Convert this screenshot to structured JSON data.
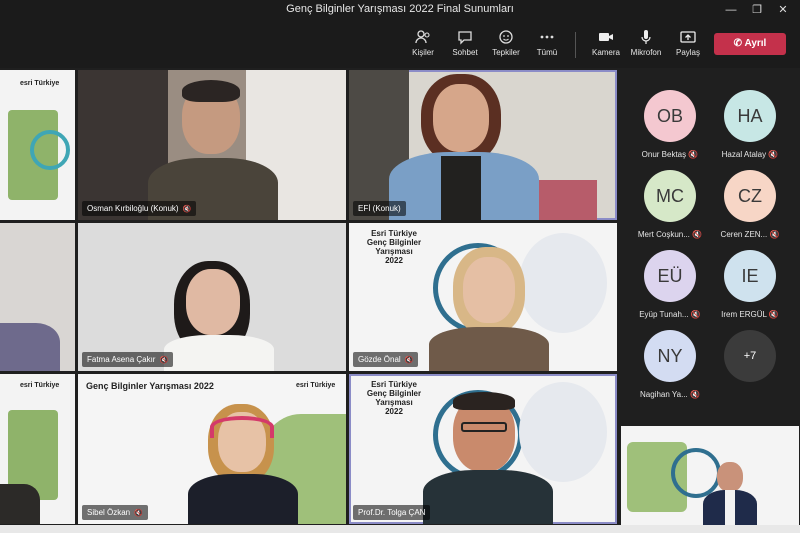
{
  "window": {
    "title": "Genç Bilginler Yarışması 2022 Final Sunumları"
  },
  "toolbar": {
    "people_label": "Kişiler",
    "chat_label": "Sohbet",
    "reactions_label": "Tepkiler",
    "more_label": "Tümü",
    "camera_label": "Kamera",
    "mic_label": "Mikrofon",
    "share_label": "Paylaş",
    "leave_label": "Ayrıl"
  },
  "tiles": [
    {
      "name": "Osman Kırbiloğlu (Konuk)"
    },
    {
      "name": "EFİ (Konuk)"
    },
    {
      "name": "Fatma Asena Çakır"
    },
    {
      "name": "Gözde Önal"
    },
    {
      "name": "Sibel Özkan"
    },
    {
      "name": "Prof.Dr. Tolga ÇAN"
    }
  ],
  "slides": {
    "esri_logo": "esri Türkiye",
    "title_stacked": [
      "Esri Türkiye",
      "Genç Bilginler Yarışması",
      "2022"
    ],
    "title_banner": "Genç Bilginler Yarışması 2022"
  },
  "roster": [
    {
      "initials": "OB",
      "name": "Onur Bektaş",
      "color": "#f4c8d0"
    },
    {
      "initials": "HA",
      "name": "Hazal Atalay",
      "color": "#c7e7e5"
    },
    {
      "initials": "MC",
      "name": "Mert Coşkun...",
      "color": "#d6e8c8"
    },
    {
      "initials": "CZ",
      "name": "Ceren ZEN...",
      "color": "#f7d6c6"
    },
    {
      "initials": "EÜ",
      "name": "Eyüp Tunah...",
      "color": "#dcd4ee"
    },
    {
      "initials": "IE",
      "name": "Irem ERGÜL",
      "color": "#cfe2ee"
    },
    {
      "initials": "NY",
      "name": "Nagihan Ya...",
      "color": "#d3dcf2"
    }
  ],
  "overflow_count": "+7",
  "colors": {
    "leave": "#c4314b",
    "active_outline": "#8b8cc7"
  }
}
